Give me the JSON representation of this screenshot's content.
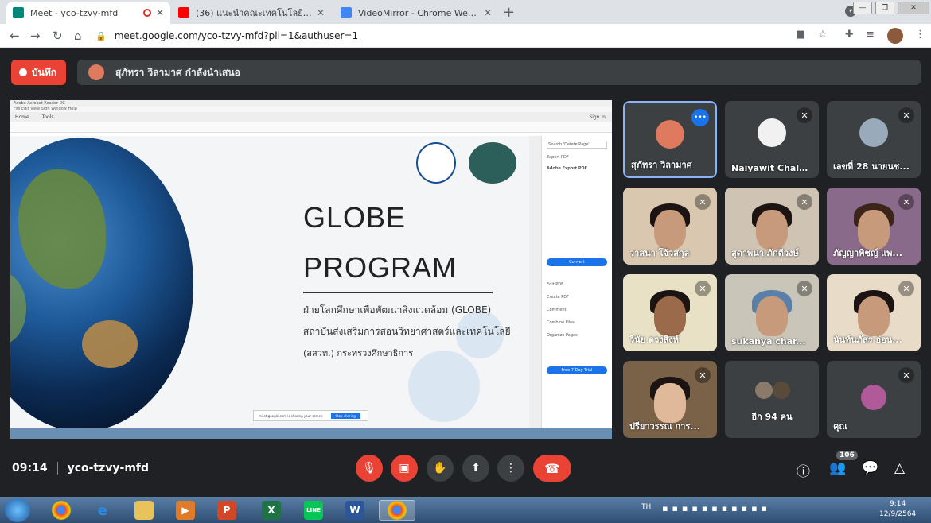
{
  "browser": {
    "tabs": [
      {
        "title": "Meet - yco-tzvy-mfd"
      },
      {
        "title": "(36) แนะนำคณะเทคโนโลยีการเกษตรแ..."
      },
      {
        "title": "VideoMirror - Chrome Web Store"
      }
    ],
    "url": "meet.google.com/yco-tzvy-mfd?pli=1&authuser=1"
  },
  "meet": {
    "record_label": "บันทึก",
    "presenting_text": "สุภัทรา วิลามาศ กำลังนำเสนอ",
    "meeting_time": "09:14",
    "meeting_code": "yco-tzvy-mfd",
    "participants_badge": "106"
  },
  "slide": {
    "title_line1": "GLOBE",
    "title_line2": "PROGRAM",
    "sub1": "ฝ่ายโลกศึกษาเพื่อพัฒนาสิ่งแวดล้อม (GLOBE)",
    "sub2": "สถาบันส่งเสริมการสอนวิทยาศาสตร์และเทคโนโลยี",
    "sub3": "(สสวท.) กระทรวงศึกษาธิการ",
    "tab_home": "Home",
    "tab_tools": "Tools",
    "sign_in": "Sign In",
    "export_pdf": "Export PDF",
    "adobe_export": "Adobe Export PDF",
    "convert": "Convert",
    "edit_pdf": "Edit PDF",
    "create_pdf": "Create PDF",
    "comment": "Comment",
    "combine_files": "Combine Files",
    "organize_pages": "Organize Pages",
    "free_trial": "Free 7-Day Trial",
    "search_tools": "Search 'Delete Page'"
  },
  "tiles": [
    {
      "name": "สุภัทรา วิลามาศ"
    },
    {
      "name": "Naiyawit Chale..."
    },
    {
      "name": "เลขที่ 28 นายนช..."
    },
    {
      "name": "วาสนา โจ้วสกุล"
    },
    {
      "name": "สุดาพนา ภักดีวงษ์"
    },
    {
      "name": "ภัญญาพิชญ์ แพ..."
    },
    {
      "name": "วินัย ดวงสิงห์"
    },
    {
      "name": "sukanya char..."
    },
    {
      "name": "นันท์นภัสร อ่อน..."
    },
    {
      "name": "ปรียาวรรณ การ..."
    },
    {
      "name": "อีก 94 คน"
    },
    {
      "name": "คุณ"
    }
  ],
  "taskbar": {
    "lang": "TH",
    "clock_time": "9:14",
    "clock_date": "12/9/2564"
  },
  "colors": {
    "meet_bg": "#202124",
    "tile_bg": "#3c4043",
    "red": "#ea4335",
    "speaking_border": "#8ab4f8"
  }
}
